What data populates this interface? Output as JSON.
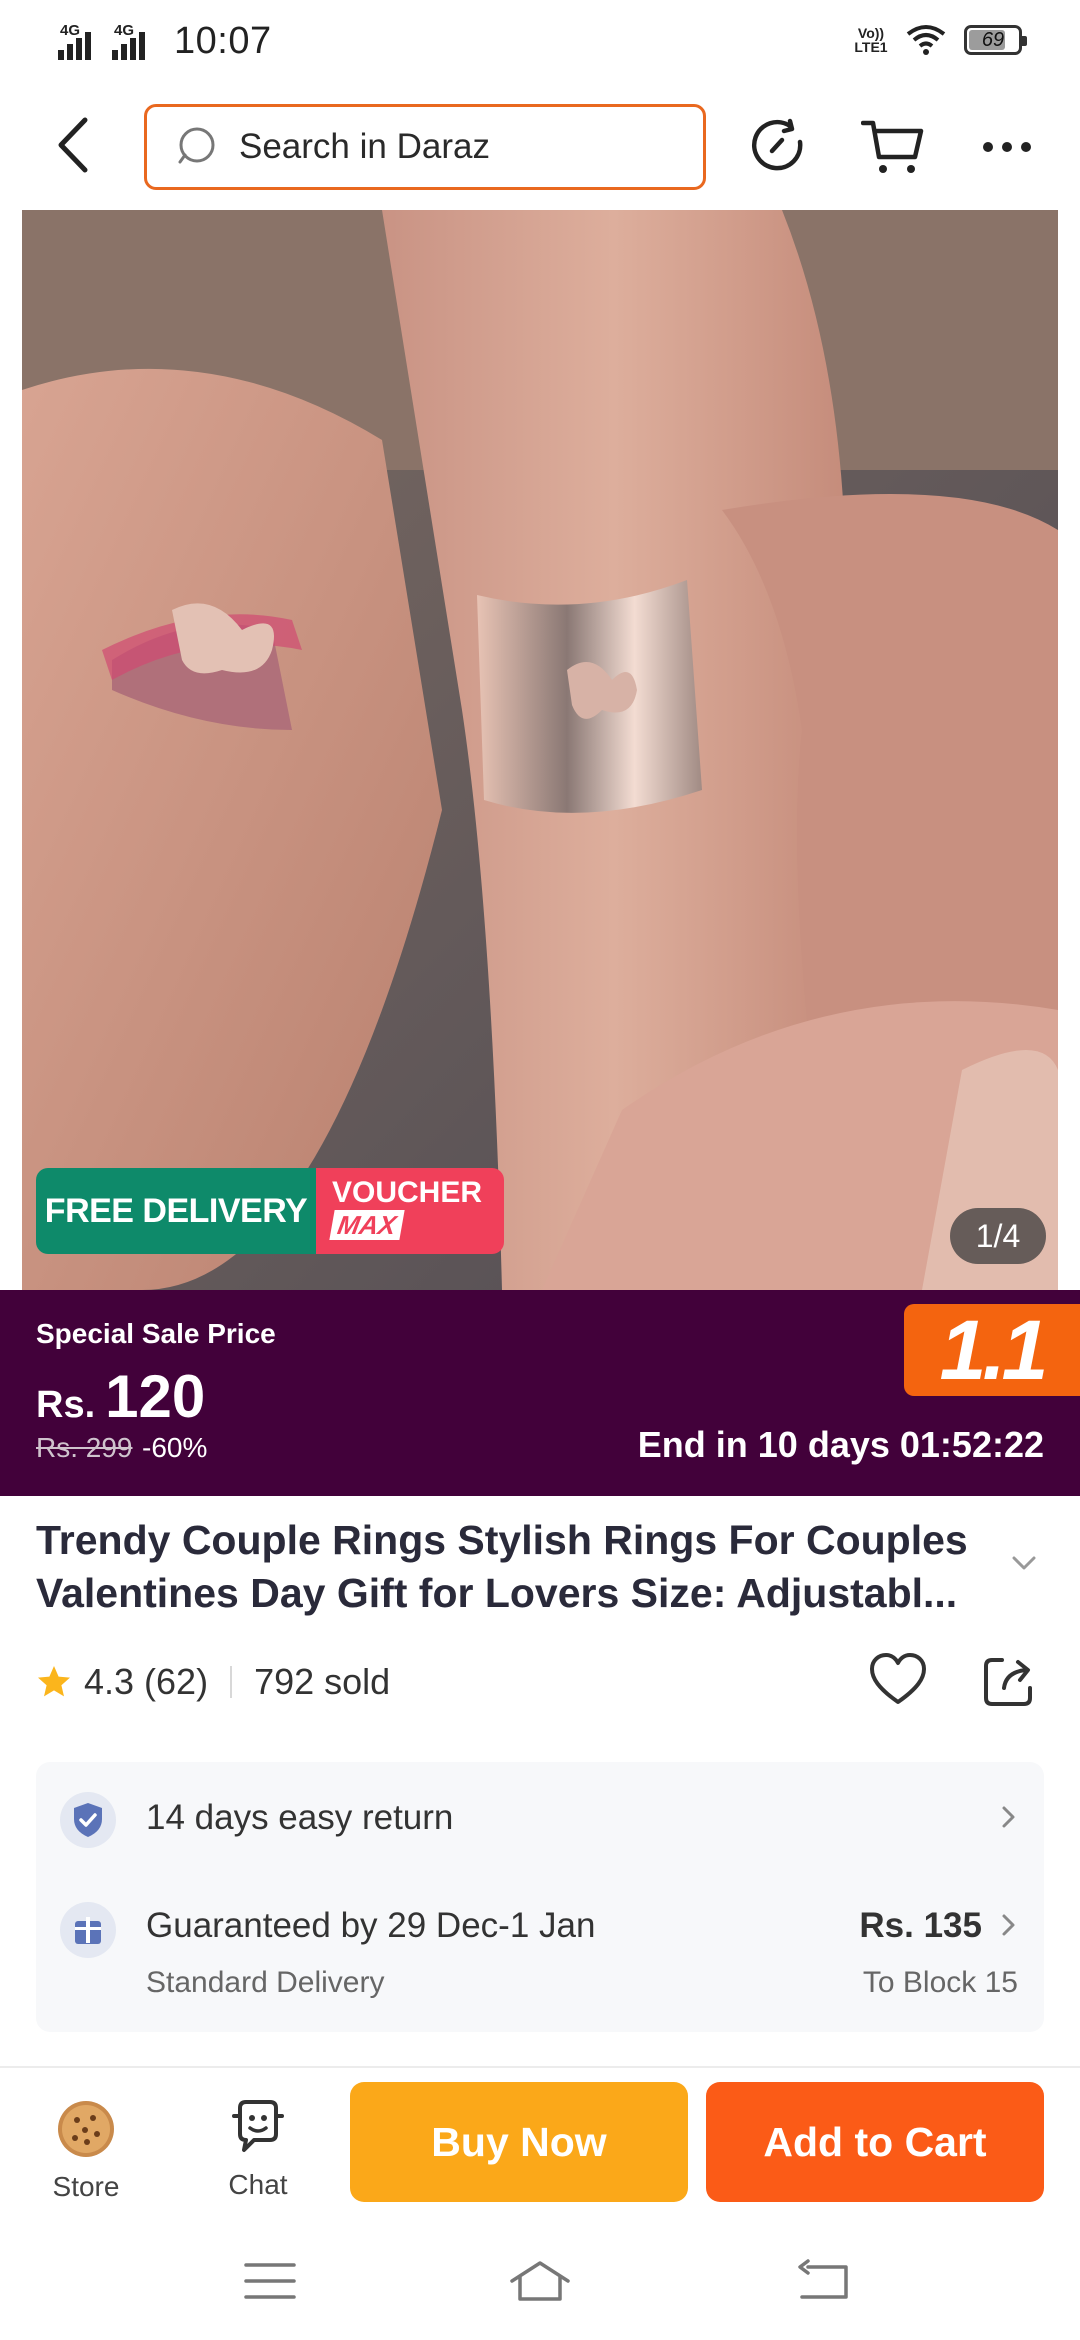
{
  "status_bar": {
    "network_1": "4G",
    "network_2": "4G",
    "time": "10:07",
    "volte": "Vo)) LTE1",
    "battery": "69"
  },
  "top_nav": {
    "search_placeholder": "Search in Daraz",
    "icons": [
      "back-icon",
      "search-icon",
      "history-icon",
      "cart-icon",
      "more-icon"
    ]
  },
  "product_image": {
    "badge_free_delivery": "FREE DELIVERY",
    "badge_voucher_line1": "VOUCHER",
    "badge_voucher_line2": "MAX",
    "counter": "1/4"
  },
  "sale": {
    "label": "Special Sale Price",
    "currency": "Rs.",
    "price": "120",
    "old_price": "Rs. 299",
    "discount": "-60%",
    "campaign": "1.1",
    "countdown": "End in 10 days 01:52:22"
  },
  "product": {
    "title": "Trendy Couple Rings Stylish Rings For Couples Valentines Day Gift for Lovers Size: Adjustabl...",
    "rating": "4.3 (62)",
    "sold": "792 sold"
  },
  "services": {
    "return_text": "14 days easy return",
    "delivery_text": "Guaranteed by 29 Dec-1 Jan",
    "delivery_type": "Standard Delivery",
    "delivery_price": "Rs. 135",
    "delivery_location": "To Block 15"
  },
  "action_bar": {
    "store_label": "Store",
    "chat_label": "Chat",
    "buy_now": "Buy Now",
    "add_to_cart": "Add to Cart"
  },
  "colors": {
    "brand_orange": "#f4640f",
    "buy_now": "#fba819",
    "add_to_cart": "#fb5b17",
    "sale_banner": "#42013a",
    "free_delivery": "#0e8a6a",
    "voucher": "#f0405a"
  }
}
